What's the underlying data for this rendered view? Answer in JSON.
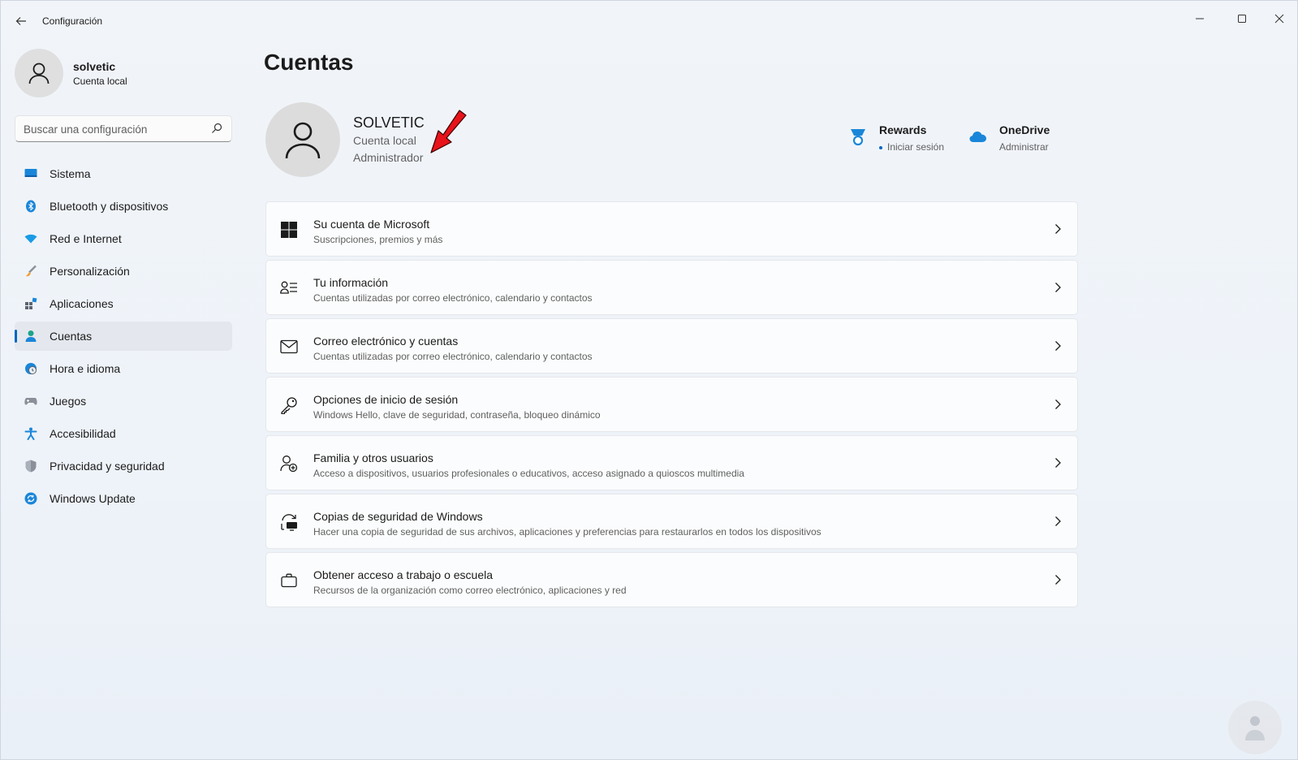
{
  "window": {
    "title": "Configuración"
  },
  "profile": {
    "name": "solvetic",
    "subtitle": "Cuenta local"
  },
  "search": {
    "placeholder": "Buscar una configuración"
  },
  "sidebar": {
    "items": [
      {
        "label": "Sistema",
        "icon": "monitor-icon"
      },
      {
        "label": "Bluetooth y dispositivos",
        "icon": "bluetooth-icon"
      },
      {
        "label": "Red e Internet",
        "icon": "wifi-icon"
      },
      {
        "label": "Personalización",
        "icon": "brush-icon"
      },
      {
        "label": "Aplicaciones",
        "icon": "apps-icon"
      },
      {
        "label": "Cuentas",
        "icon": "person-icon",
        "active": true
      },
      {
        "label": "Hora e idioma",
        "icon": "clock-globe-icon"
      },
      {
        "label": "Juegos",
        "icon": "gamepad-icon"
      },
      {
        "label": "Accesibilidad",
        "icon": "accessibility-icon"
      },
      {
        "label": "Privacidad y seguridad",
        "icon": "shield-icon"
      },
      {
        "label": "Windows Update",
        "icon": "update-icon"
      }
    ]
  },
  "main": {
    "title": "Cuentas",
    "account": {
      "name": "SOLVETIC",
      "type": "Cuenta local",
      "role": "Administrador"
    },
    "services": {
      "rewards": {
        "title": "Rewards",
        "subtitle": "Iniciar sesión"
      },
      "onedrive": {
        "title": "OneDrive",
        "subtitle": "Administrar"
      }
    },
    "cards": [
      {
        "title": "Su cuenta de Microsoft",
        "subtitle": "Suscripciones, premios y más",
        "icon": "windows-logo-icon"
      },
      {
        "title": "Tu información",
        "subtitle": "Cuentas utilizadas por correo electrónico, calendario y contactos",
        "icon": "person-info-icon"
      },
      {
        "title": "Correo electrónico y cuentas",
        "subtitle": "Cuentas utilizadas por correo electrónico, calendario y contactos",
        "icon": "mail-icon"
      },
      {
        "title": "Opciones de inicio de sesión",
        "subtitle": "Windows Hello, clave de seguridad, contraseña, bloqueo dinámico",
        "icon": "key-icon"
      },
      {
        "title": "Familia y otros usuarios",
        "subtitle": "Acceso a dispositivos, usuarios profesionales o educativos, acceso asignado a quioscos multimedia",
        "icon": "person-add-icon"
      },
      {
        "title": "Copias de seguridad de Windows",
        "subtitle": "Hacer una copia de seguridad de sus archivos, aplicaciones y preferencias para restaurarlos en todos los dispositivos",
        "icon": "backup-icon"
      },
      {
        "title": "Obtener acceso a trabajo o escuela",
        "subtitle": "Recursos de la organización como correo electrónico, aplicaciones y red",
        "icon": "briefcase-icon"
      }
    ]
  },
  "colors": {
    "accent": "#0067c0",
    "annotation_arrow": "#e8131b"
  }
}
